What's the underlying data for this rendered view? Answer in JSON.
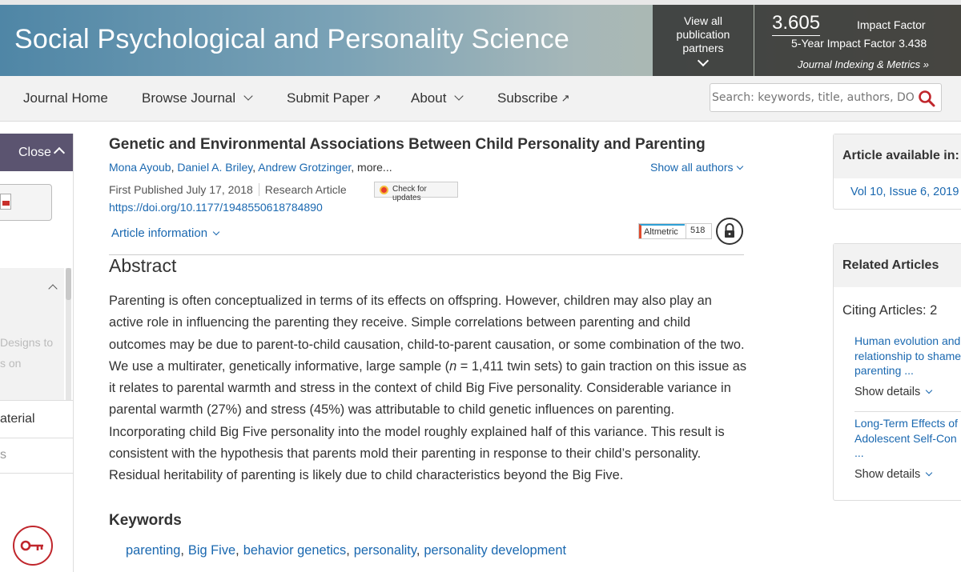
{
  "header": {
    "journal_title": "Social Psychological and Personality Science",
    "partners_line1": "View all",
    "partners_line2": "publication",
    "partners_line3": "partners",
    "impact_factor_value": "3.605",
    "impact_factor_label": "Impact Factor",
    "five_year_if": "5-Year Impact Factor 3.438",
    "indexing_link": "Journal Indexing & Metrics »"
  },
  "nav": {
    "home": "Journal Home",
    "browse": "Browse Journal",
    "submit": "Submit Paper",
    "about": "About",
    "subscribe": "Subscribe",
    "search_placeholder": "Search: keywords, title, authors, DOI"
  },
  "left_panel": {
    "close_label": "Close",
    "faded_line1": "Designs to",
    "faded_line2": "s on",
    "row1": "aterial",
    "row2": "s"
  },
  "article": {
    "title": "Genetic and Environmental Associations Between Child Personality and Parenting",
    "authors": [
      "Mona Ayoub",
      "Daniel A. Briley",
      "Andrew Grotzinger"
    ],
    "more": "more...",
    "show_all_authors": "Show all authors",
    "first_published": "First Published July 17, 2018",
    "article_type": "Research Article",
    "check_updates": "Check for updates",
    "doi": "https://doi.org/10.1177/1948550618784890",
    "article_information": "Article information",
    "altmetric_label": "Altmetric",
    "altmetric_score": "518",
    "abstract_heading": "Abstract",
    "abstract_p1": "Parenting is often conceptualized in terms of its effects on offspring. However, children may also play an active role in influencing the parenting they receive. Simple correlations between parenting and child outcomes may be due to parent-to-child causation, child-to-parent causation, or some combination of the two. We use a multirater, genetically informative, large sample (",
    "abstract_n": "n",
    "abstract_p2": " = 1,411 twin sets) to gain traction on this issue as it relates to parental warmth and stress in the context of child Big Five personality. Considerable variance in parental warmth (27%) and stress (45%) was attributable to child genetic influences on parenting. Incorporating child Big Five personality into the model roughly explained half of this variance. This result is consistent with the hypothesis that parents mold their parenting in response to their child’s personality. Residual heritability of parenting is likely due to child characteristics beyond the Big Five.",
    "keywords_heading": "Keywords",
    "keywords": [
      "parenting",
      "Big Five",
      "behavior genetics",
      "personality",
      "personality development"
    ]
  },
  "right": {
    "available_title": "Article available in:",
    "issue_link": "Vol 10, Issue 6, 2019",
    "related_title": "Related Articles",
    "citing": "Citing Articles: 2",
    "ra1_title": "Human evolution and the relationship to shame and parenting ...",
    "ra1_lines": [
      "Human evolution and",
      "relationship to shame",
      "parenting ..."
    ],
    "ra2_lines": [
      "Long-Term Effects of",
      "Adolescent Self-Con",
      "..."
    ],
    "show_details": "Show details"
  },
  "colors": {
    "link": "#1a68b0",
    "close_bg": "#5b5470",
    "key_red": "#c0262c",
    "search_icon": "#c0262c"
  }
}
